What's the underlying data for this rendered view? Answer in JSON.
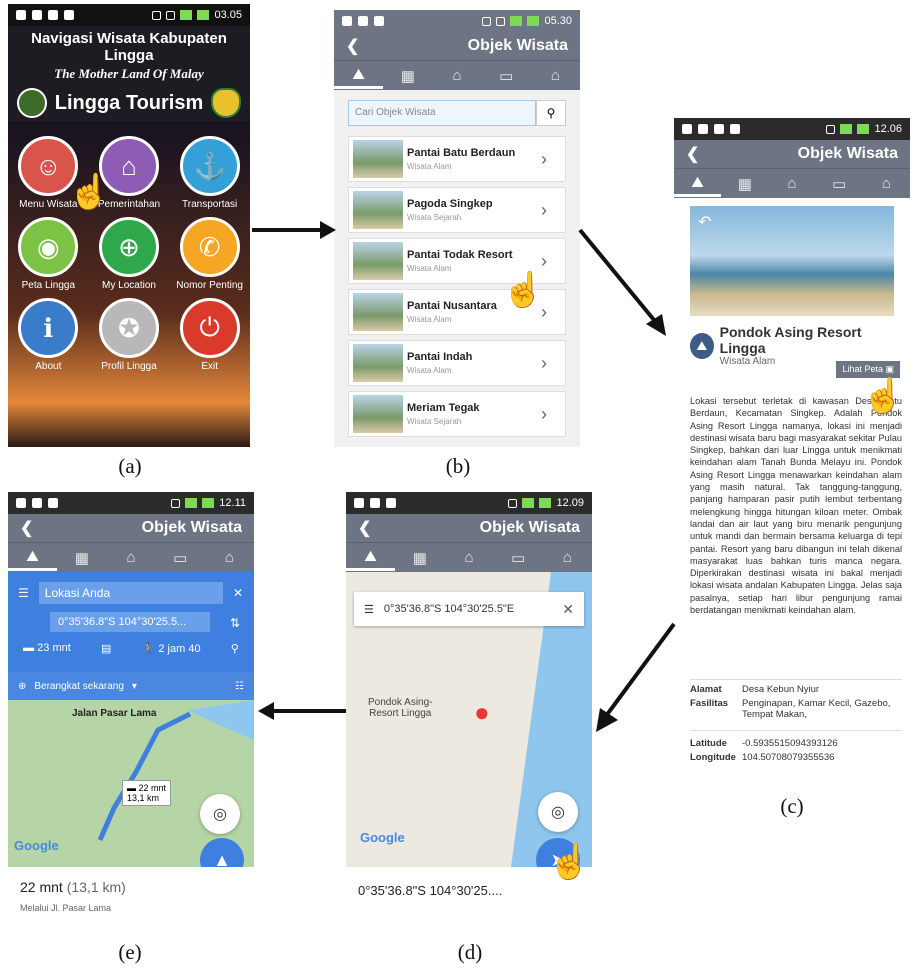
{
  "captions": [
    "(a)",
    "(b)",
    "(c)",
    "(d)",
    "(e)"
  ],
  "panel_a": {
    "status_time": "03.05",
    "title": "Navigasi Wisata Kabupaten Lingga",
    "subtitle": "The Mother Land Of Malay",
    "brand": "Lingga Tourism",
    "menu": [
      {
        "label": "Menu Wisata",
        "color": "#d9544a",
        "icon": "tourist-icon"
      },
      {
        "label": "Pemerintahan",
        "color": "#8e5bb5",
        "icon": "building-icon"
      },
      {
        "label": "Transportasi",
        "color": "#34a0d8",
        "icon": "anchor-icon"
      },
      {
        "label": "Peta Lingga",
        "color": "#7cc245",
        "icon": "map-icon"
      },
      {
        "label": "My Location",
        "color": "#2ea84a",
        "icon": "location-icon"
      },
      {
        "label": "Nomor Penting",
        "color": "#f5a623",
        "icon": "phone-icon"
      },
      {
        "label": "About",
        "color": "#3a7cc9",
        "icon": "info-icon"
      },
      {
        "label": "Profil Lingga",
        "color": "#b8b8b8",
        "icon": "crest-icon"
      },
      {
        "label": "Exit",
        "color": "#d93a2b",
        "icon": "power-icon"
      }
    ]
  },
  "panel_b": {
    "status_time": "05.30",
    "appbar_title": "Objek Wisata",
    "search_placeholder": "Cari Objek Wisata",
    "items": [
      {
        "name": "Pantai Batu Berdaun",
        "category": "Wisata Alam"
      },
      {
        "name": "Pagoda Singkep",
        "category": "Wisata Sejarah"
      },
      {
        "name": "Pantai Todak Resort",
        "category": "Wisata Alam"
      },
      {
        "name": "Pantai Nusantara",
        "category": "Wisata Alam"
      },
      {
        "name": "Pantai Indah",
        "category": "Wisata Alam"
      },
      {
        "name": "Meriam Tegak",
        "category": "Wisata Sejarah"
      }
    ]
  },
  "panel_c": {
    "status_time": "12.06",
    "appbar_title": "Objek Wisata",
    "place_name": "Pondok Asing Resort Lingga",
    "place_category": "Wisata Alam",
    "map_button": "Lihat Peta",
    "description": "Lokasi tersebut terletak di kawasan Desa Batu Berdaun, Kecamatan Singkep. Adalah Pondok Asing Resort Lingga namanya, lokasi ini menjadi destinasi wisata baru bagi masyarakat sekitar Pulau Singkep, bahkan dari luar Lingga untuk menikmati keindahan alam Tanah Bunda Melayu ini. Pondok Asing Resort Lingga menawarkan keindahan alam yang masih natural. Tak tanggung-tanggung, panjang hamparan pasir putih lembut terbentang melengkung hingga hitungan kiloan meter. Ombak landai dan air laut yang biru menarik pengunjung untuk mandi dan bermain bersama keluarga di tepi pantai. Resort yang baru dibangun ini telah dikenal masyarakat luas bahkan turis manca negara. Diperkirakan destinasi wisata ini bakal menjadi lokasi wisata andalan Kabupaten Lingga. Jelas saja pasalnya, setiap hari libur pengunjung ramai berdatangan menikmati keindahan alam.",
    "alamat_label": "Alamat",
    "alamat": "Desa Kebun Nyiur",
    "fasilitas_label": "Fasilitas",
    "fasilitas": "Penginapan, Kamar Kecil, Gazebo, Tempat Makan,",
    "lat_label": "Latitude",
    "lat": "-0.5935515094393126",
    "lon_label": "Longitude",
    "lon": "104.50708079355536"
  },
  "panel_d": {
    "status_time": "12.09",
    "appbar_title": "Objek Wisata",
    "coord_search": "0°35'36.8\"S 104°30'25.5\"E",
    "marker_label": "Pondok Asing-\nResort Lingga",
    "google": "Google",
    "bottom_text": "0°35'36.8\"S 104°30'25...."
  },
  "panel_e": {
    "status_time": "12.11",
    "appbar_title": "Objek Wisata",
    "from": "Lokasi Anda",
    "to": "0°35'36.8\"S 104°30'25.5...",
    "car_time": "23 mnt",
    "walk_time": "2 jam 40",
    "depart": "Berangkat sekarang",
    "road_label": "Jalan Pasar Lama",
    "route_time": "22 mnt",
    "route_dist": "13,1 km",
    "google": "Google",
    "summary_time": "22 mnt",
    "summary_dist": "(13,1 km)",
    "via": "Melalui Jl. Pasar Lama"
  }
}
